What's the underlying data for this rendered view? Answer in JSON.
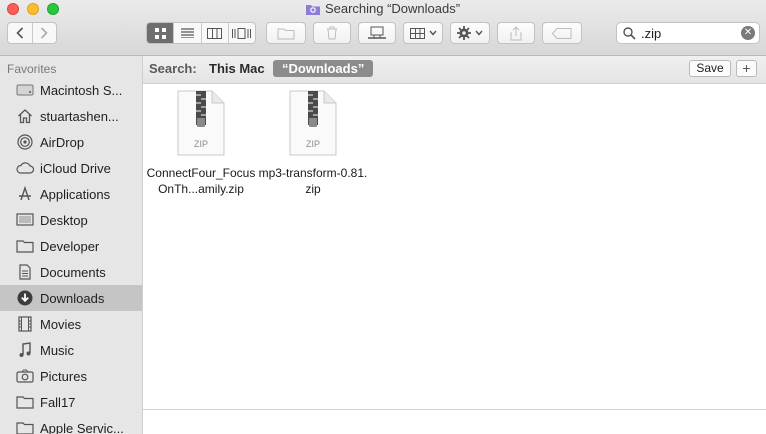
{
  "window": {
    "title": "Searching “Downloads”"
  },
  "toolbar": {
    "back_icon": "chevron-left-icon",
    "forward_icon": "chevron-right-icon",
    "view_modes": [
      "icon-view-icon",
      "list-view-icon",
      "column-view-icon",
      "cover-flow-icon"
    ],
    "active_view": "icon-view-icon"
  },
  "search": {
    "query": ".zip"
  },
  "sidebar": {
    "heading": "Favorites",
    "items": [
      {
        "label": "Macintosh S...",
        "icon": "hard-drive-icon"
      },
      {
        "label": "stuartashen...",
        "icon": "home-icon"
      },
      {
        "label": "AirDrop",
        "icon": "airdrop-icon"
      },
      {
        "label": "iCloud Drive",
        "icon": "cloud-icon"
      },
      {
        "label": "Applications",
        "icon": "applications-icon"
      },
      {
        "label": "Desktop",
        "icon": "desktop-icon"
      },
      {
        "label": "Developer",
        "icon": "folder-icon"
      },
      {
        "label": "Documents",
        "icon": "documents-icon"
      },
      {
        "label": "Downloads",
        "icon": "download-icon",
        "selected": true
      },
      {
        "label": "Movies",
        "icon": "film-icon"
      },
      {
        "label": "Music",
        "icon": "music-note-icon"
      },
      {
        "label": "Pictures",
        "icon": "camera-icon"
      },
      {
        "label": "Fall17",
        "icon": "folder-icon"
      },
      {
        "label": "Apple Servic...",
        "icon": "folder-icon"
      }
    ]
  },
  "scope_bar": {
    "label": "Search:",
    "this_mac": "This Mac",
    "downloads": "“Downloads”",
    "save": "Save",
    "add": "+"
  },
  "files": [
    {
      "name": "ConnectFour_FocusOnTh...amily.zip",
      "badge": "ZIP"
    },
    {
      "name": "mp3-transform-0.81.zip",
      "badge": "ZIP"
    }
  ],
  "colors": {
    "selection": "#c5c5c5",
    "sidebar_bg": "#e6e6e6",
    "scope_token": "#8c8c8c"
  }
}
